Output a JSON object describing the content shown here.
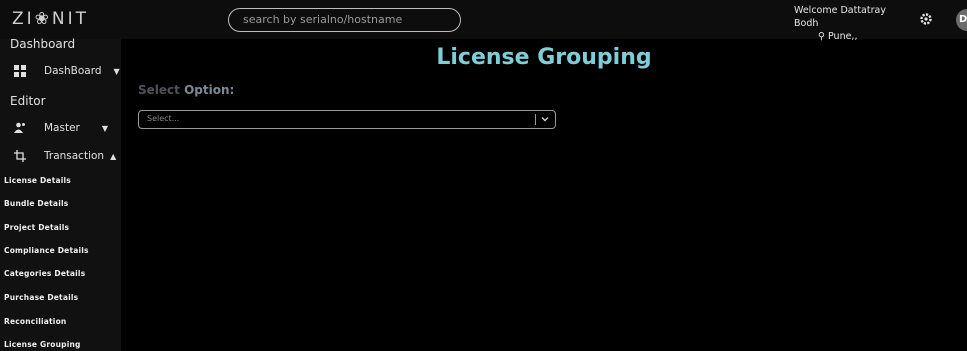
{
  "header": {
    "logo": "ZI❀NIT",
    "search_placeholder": "search by serialno/hostname",
    "welcome": "Welcome Dattatray Bodh",
    "location": "Pune,,",
    "avatar_initials": "DB"
  },
  "sidebar": {
    "sections": [
      {
        "heading": "Dashboard"
      },
      {
        "heading": "Editor"
      }
    ],
    "items": [
      {
        "label": "DashBoard",
        "icon": "dashboard-grid-icon"
      },
      {
        "label": "Master",
        "icon": "users-icon"
      },
      {
        "label": "Transaction",
        "icon": "crop-icon"
      }
    ],
    "subitems": [
      "License Details",
      "Bundle Details",
      "Project Details",
      "Compliance Details",
      "Categories Details",
      "Purchase Details",
      "Reconciliation",
      "License Grouping"
    ]
  },
  "main": {
    "title": "License Grouping",
    "select_label_pre": "Select",
    "select_label_post": "Option:",
    "select_placeholder": "Select..."
  },
  "colors": {
    "title": "#7ccfd8",
    "background": "#000000",
    "sidebar": "#111111"
  }
}
